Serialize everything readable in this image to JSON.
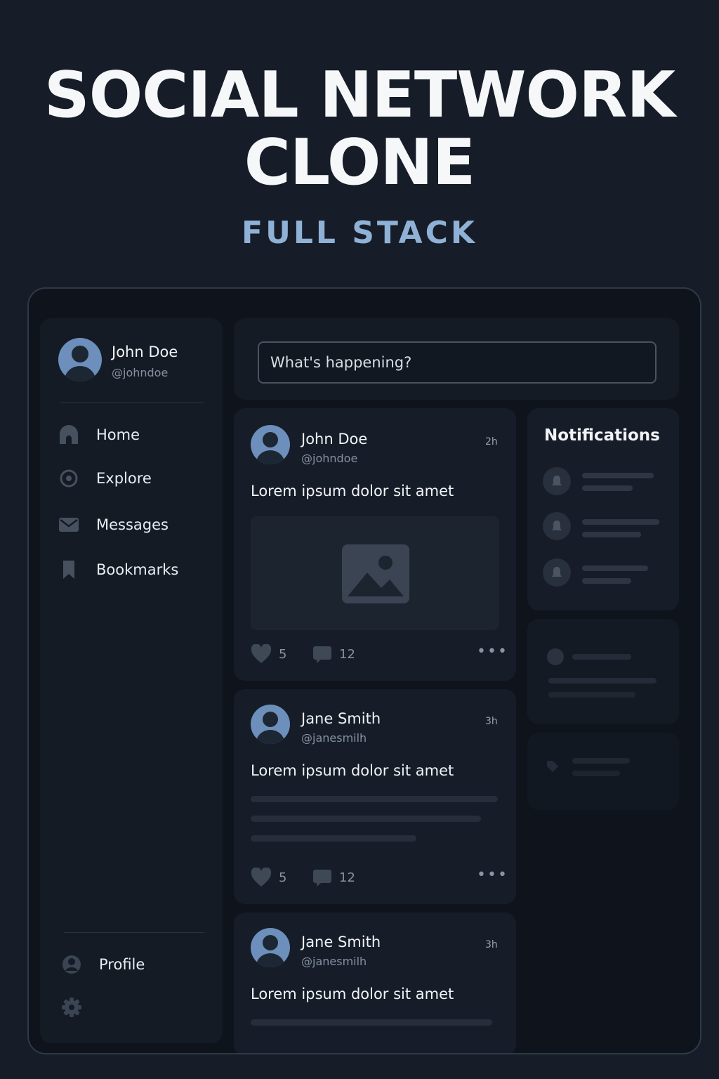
{
  "hero": {
    "title_line1": "SOCIAL NETWORK",
    "title_line2": "CLONE",
    "subtitle": "FULL STACK"
  },
  "sidebar": {
    "user": {
      "name": "John Doe",
      "handle": "@johndoe"
    },
    "items": [
      {
        "label": "Home",
        "icon": "home-icon"
      },
      {
        "label": "Explore",
        "icon": "compass-icon"
      },
      {
        "label": "Messages",
        "icon": "mail-icon"
      },
      {
        "label": "Bookmarks",
        "icon": "bookmark-icon"
      }
    ],
    "profile_label": "Profile",
    "settings_icon": "gear-icon"
  },
  "compose": {
    "placeholder": "What's happening?"
  },
  "posts": [
    {
      "name": "John Doe",
      "handle": "@johndoe",
      "time": "2h",
      "text": "Lorem ipsum dolor sit amet",
      "likes": "5",
      "comments": "12"
    },
    {
      "name": "Jane Smith",
      "handle": "@janesmilh",
      "time": "3h",
      "text": "Lorem ipsum dolor sit amet",
      "likes": "5",
      "comments": "12"
    },
    {
      "name": "Jane Smith",
      "handle": "@janesmilh",
      "time": "3h",
      "text": "Lorem ipsum dolor sit amet"
    }
  ],
  "notifications": {
    "title": "Notifications"
  },
  "colors": {
    "background": "#161d28",
    "accent": "#8fb1d6",
    "avatar": "#6d8fbb"
  }
}
